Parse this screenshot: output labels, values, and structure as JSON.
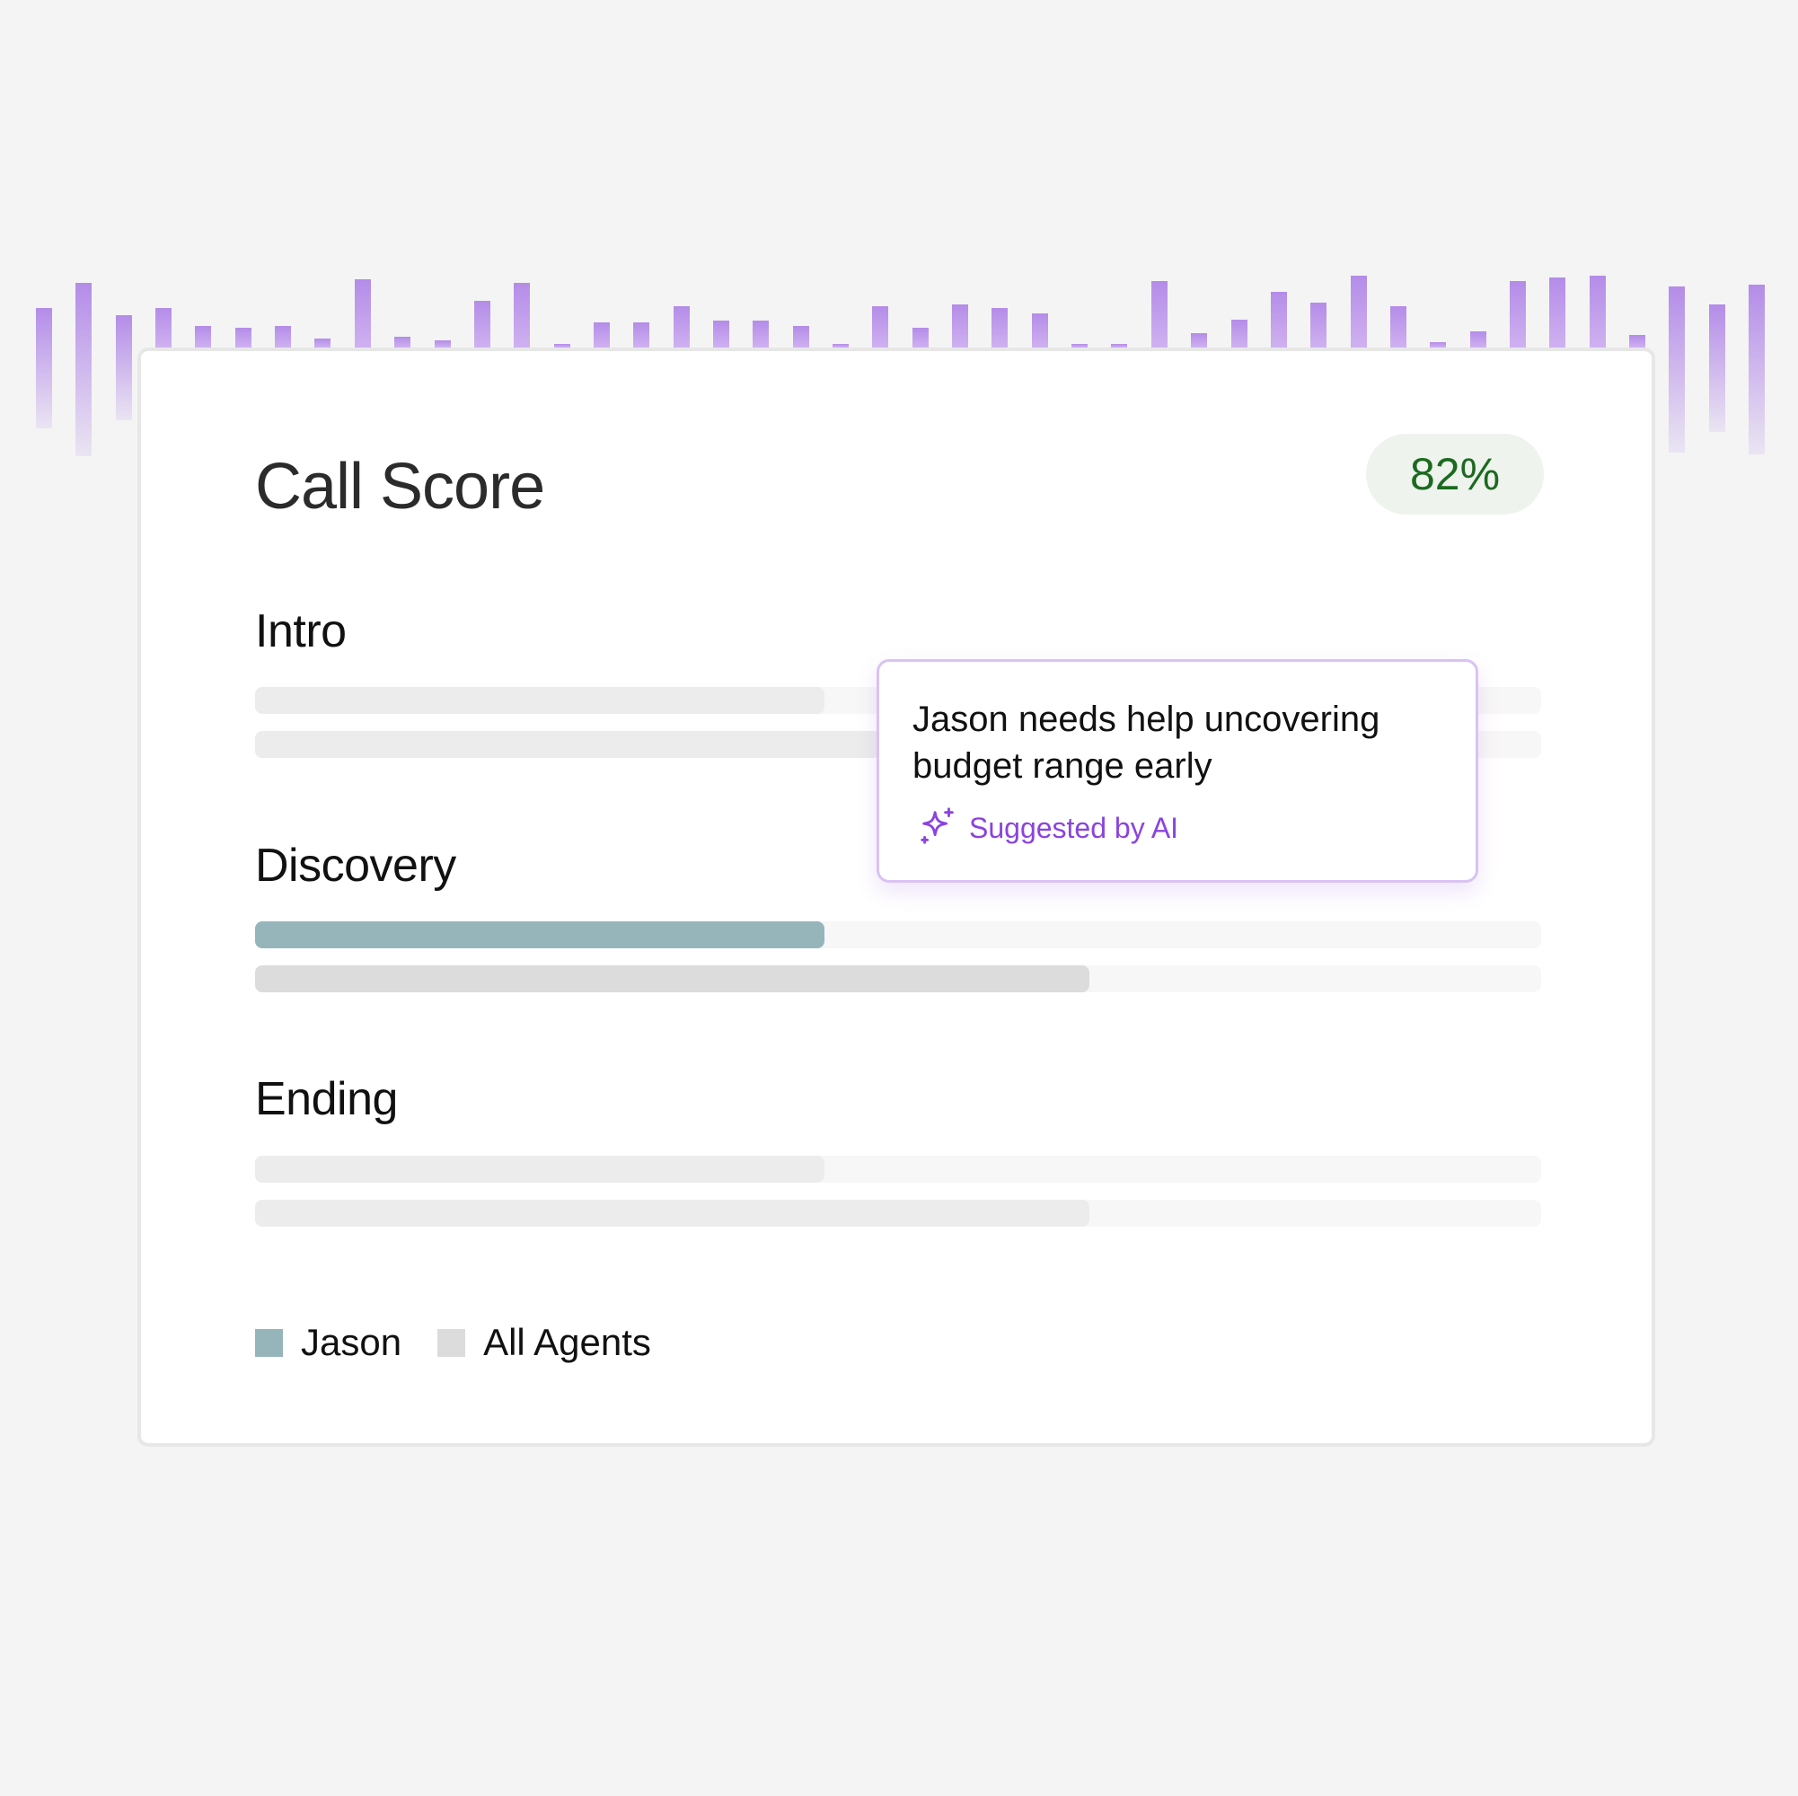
{
  "title": "Call Score",
  "score": "82%",
  "colors": {
    "background": "#f4f4f4",
    "wave_bar": "#b48ce8",
    "jason": "#96b5bb",
    "all_agents": "#dcdcdc",
    "muted_bar": "#ececec",
    "track": "#f7f7f7",
    "score_text": "#1c6a1f",
    "ai_accent": "#8b43de"
  },
  "waveform": {
    "description_free": true,
    "levels": [
      0.55,
      0.9,
      0.45,
      0.55,
      0.3,
      0.27,
      0.3,
      0.12,
      0.95,
      0.15,
      0.1,
      0.65,
      0.9,
      0.05,
      0.35,
      0.35,
      0.58,
      0.38,
      0.38,
      0.3,
      0.0,
      0.58,
      0.28,
      0.6,
      0.55,
      0.48,
      0.05,
      0.05,
      0.92,
      0.2,
      0.39,
      0.77,
      0.63,
      1.0,
      0.58,
      0.08,
      0.22,
      0.92,
      0.97,
      1.0,
      0.18,
      0.85,
      0.6,
      0.88
    ]
  },
  "sections": [
    {
      "label": "Intro",
      "muted": true,
      "bars": [
        {
          "series": "Jason",
          "value": 0.443
        },
        {
          "series": "All Agents",
          "value": 0.649
        }
      ]
    },
    {
      "label": "Discovery",
      "muted": false,
      "bars": [
        {
          "series": "Jason",
          "value": 0.443
        },
        {
          "series": "All Agents",
          "value": 0.649
        }
      ]
    },
    {
      "label": "Ending",
      "muted": true,
      "bars": [
        {
          "series": "Jason",
          "value": 0.443
        },
        {
          "series": "All Agents",
          "value": 0.649
        }
      ]
    }
  ],
  "tooltip": {
    "text": "Jason needs help uncovering budget range early",
    "ai_label": "Suggested by AI",
    "icon": "sparkle-icon"
  },
  "legend": [
    {
      "name": "Jason",
      "key": "jason"
    },
    {
      "name": "All Agents",
      "key": "all_agents"
    }
  ]
}
